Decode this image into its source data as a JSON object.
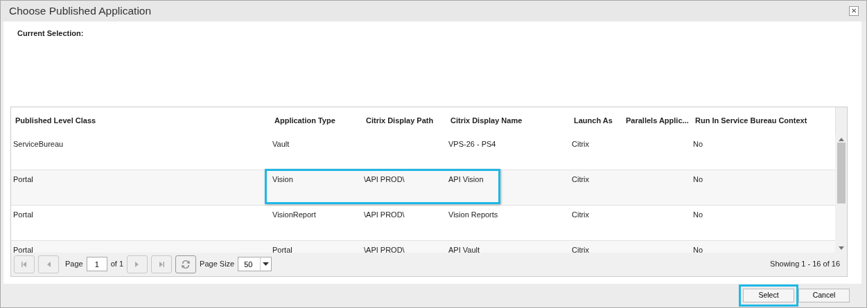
{
  "window": {
    "title": "Choose Published Application",
    "close": "✕"
  },
  "current_selection": {
    "label": "Current Selection:"
  },
  "table": {
    "columns": [
      "Published Level Class",
      "Application Type",
      "Citrix Display Path",
      "Citrix Display Name",
      "Launch As",
      "Parallels Applic...",
      "Run In Service Bureau Context"
    ],
    "rows": [
      {
        "cells": [
          "ServiceBureau",
          "Vault",
          "",
          "VPS-26 - PS4",
          "Citrix",
          "",
          "No"
        ],
        "callout": false
      },
      {
        "cells": [
          "Portal",
          "Vision",
          "\\API PROD\\",
          "API Vision",
          "Citrix",
          "",
          "No"
        ],
        "callout": true
      },
      {
        "cells": [
          "Portal",
          "VisionReport",
          "\\API PROD\\",
          "Vision Reports",
          "Citrix",
          "",
          "No"
        ],
        "callout": false
      },
      {
        "cells": [
          "Portal",
          "Portal",
          "\\API PROD\\",
          "API Vault",
          "Citrix",
          "",
          "No"
        ],
        "callout": false
      }
    ]
  },
  "pager": {
    "page_label": "Page",
    "page": "1",
    "of_label": "of 1",
    "first_disabled": true,
    "prev_disabled": true,
    "next_disabled": true,
    "last_disabled": true,
    "page_size_label": "Page Size",
    "page_size": "50",
    "summary": "Showing 1 - 16 of 16"
  },
  "buttons": [
    {
      "label": "Select",
      "callout": true
    },
    {
      "label": "Cancel",
      "callout": false
    }
  ]
}
